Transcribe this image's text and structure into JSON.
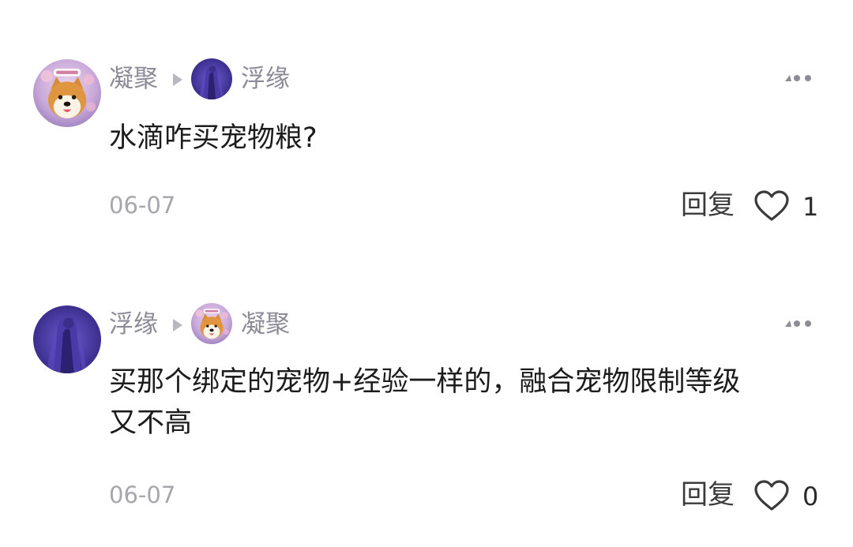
{
  "comments": [
    {
      "author": "凝聚",
      "reply_to": "浮缘",
      "text": "水滴咋买宠物粮?",
      "date": "06-07",
      "reply_label": "回复",
      "likes": "1"
    },
    {
      "author": "浮缘",
      "reply_to": "凝聚",
      "text": "买那个绑定的宠物+经验一样的，融合宠物限制等级\n又不高",
      "date": "06-07",
      "reply_label": "回复",
      "likes": "0"
    }
  ],
  "icons": {
    "author_to_reply": "triangle-right-icon",
    "more": "more-dots-icon",
    "like": "heart-outline-icon"
  },
  "colors": {
    "username": "#8c8a96",
    "date": "#a7a6ad",
    "text": "#1c1c1c",
    "icon": "#3a3a3a"
  }
}
